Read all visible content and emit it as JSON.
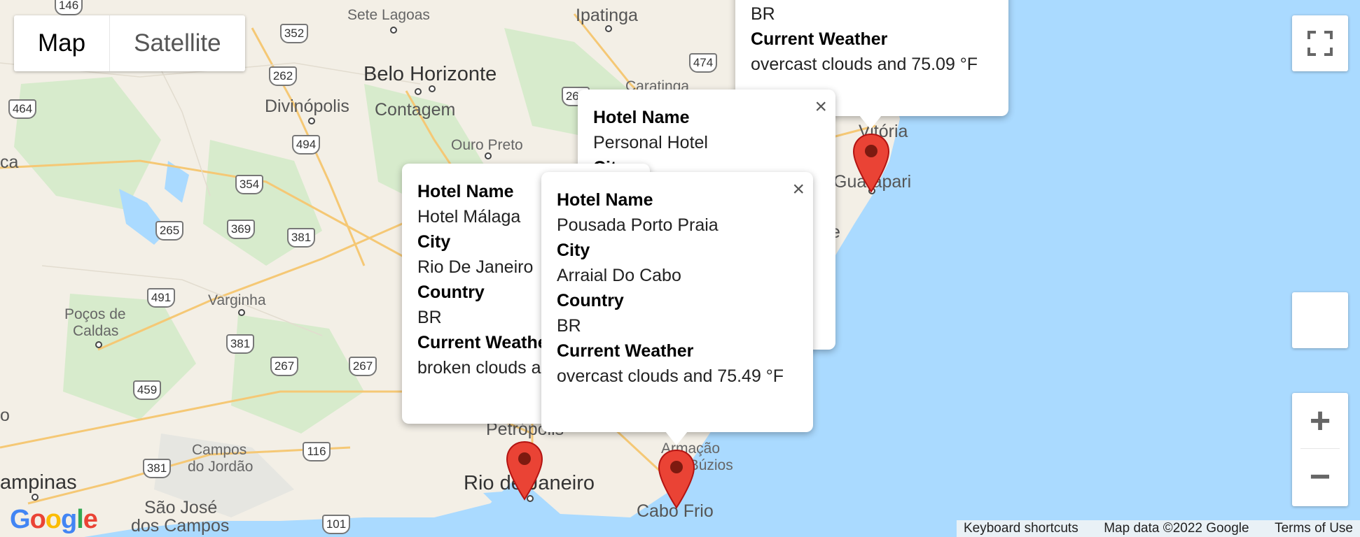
{
  "map_type": {
    "map_label": "Map",
    "satellite_label": "Satellite",
    "selected": "Map"
  },
  "cities": {
    "sete_lagoas": "Sete Lagoas",
    "ipatinga": "Ipatinga",
    "belo_horizonte": "Belo Horizonte",
    "divinopolis": "Divinópolis",
    "contagem": "Contagem",
    "caratinga": "Caratinga",
    "ouro_preto": "Ouro Preto",
    "vitoria": "Vitória",
    "guarapari": "Guarapari",
    "cachoeiro": "ca",
    "pocos_l1": "Poços de",
    "pocos_l2": "Caldas",
    "varginha": "Varginha",
    "petropolis": "Petrópolis",
    "rio": "Rio de Janeiro",
    "armacao_l1": "Armação",
    "armacao_l2": "dos Búzios",
    "cabo_frio": "Cabo Frio",
    "campinas": "ampinas",
    "campos_l1": "Campos",
    "campos_l2": "do Jordão",
    "sjc_l1": "São José",
    "sjc_l2": "dos Campos",
    "anchieta": "e",
    "edge_o": "o"
  },
  "highways": [
    "146",
    "352",
    "262",
    "474",
    "464",
    "494",
    "354",
    "369",
    "265",
    "381",
    "491",
    "381",
    "267",
    "267",
    "459",
    "116",
    "381",
    "101",
    "262"
  ],
  "info_windows": [
    {
      "id": "vitoria",
      "country": "BR",
      "weather_label": "Current Weather",
      "weather": "overcast clouds and 75.09 °F"
    },
    {
      "id": "personal",
      "hotel_label": "Hotel Name",
      "hotel": "Personal Hotel",
      "city_label": "City"
    },
    {
      "id": "malaga",
      "hotel_label": "Hotel Name",
      "hotel": "Hotel Málaga",
      "city_label": "City",
      "city": "Rio De Janeiro",
      "country_label": "Country",
      "country": "BR",
      "weather_label": "Current Weathe",
      "weather": "broken clouds a"
    },
    {
      "id": "porto_praia",
      "hotel_label": "Hotel Name",
      "hotel": "Pousada Porto Praia",
      "city_label": "City",
      "city": "Arraial Do Cabo",
      "country_label": "Country",
      "country": "BR",
      "weather_label": "Current Weather",
      "weather": "overcast clouds and 75.49 °F"
    }
  ],
  "close_glyph": "×",
  "controls": {
    "zoom_in": "+",
    "zoom_out": "−"
  },
  "footer": {
    "keyboard": "Keyboard shortcuts",
    "map_data": "Map data ©2022 Google",
    "terms": "Terms of Use"
  },
  "logo": "Google",
  "colors": {
    "land": "#f3efe6",
    "green": "#cfe8c4",
    "water": "#aadaff",
    "pin": "#ea4335",
    "road": "#f9d98a"
  }
}
